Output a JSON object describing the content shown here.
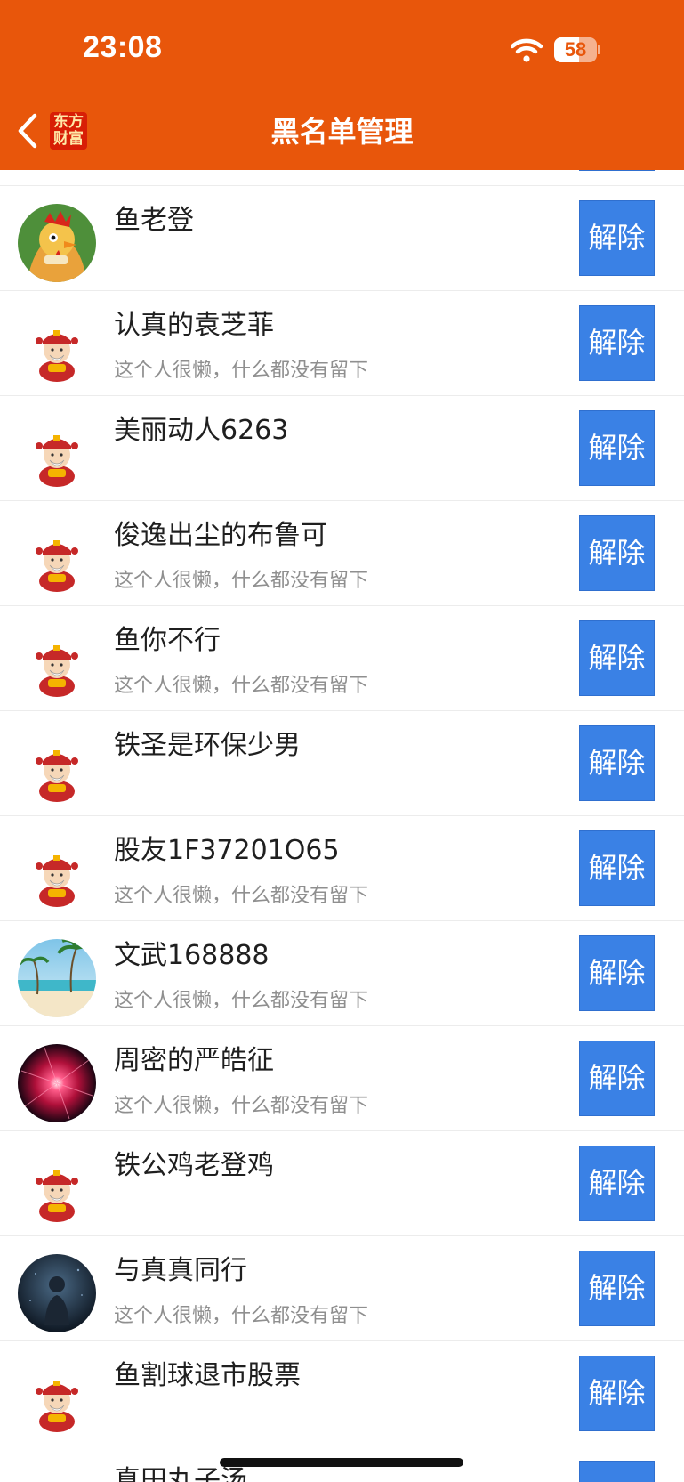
{
  "colors": {
    "brand": "#E8560B",
    "button": "#3A81E5"
  },
  "status_bar": {
    "time": "23:08",
    "battery": "58",
    "battery_level": 0.58
  },
  "header": {
    "title": "黑名单管理",
    "logo_line1": "东方",
    "logo_line2": "财富",
    "back_icon": "chevron-left-icon"
  },
  "list": {
    "button_label": "解除",
    "rows": [
      {
        "name": "鱼老登",
        "subtitle": "",
        "avatar": "rooster"
      },
      {
        "name": "认真的袁芝菲",
        "subtitle": "这个人很懒，什么都没有留下",
        "avatar": "god-of-wealth"
      },
      {
        "name": "美丽动人6263",
        "subtitle": "",
        "avatar": "god-of-wealth"
      },
      {
        "name": "俊逸出尘的布鲁可",
        "subtitle": "这个人很懒，什么都没有留下",
        "avatar": "god-of-wealth"
      },
      {
        "name": "鱼你不行",
        "subtitle": "这个人很懒，什么都没有留下",
        "avatar": "god-of-wealth"
      },
      {
        "name": "铁圣是环保少男",
        "subtitle": "",
        "avatar": "god-of-wealth"
      },
      {
        "name": "股友1F37201O65",
        "subtitle": "这个人很懒，什么都没有留下",
        "avatar": "god-of-wealth"
      },
      {
        "name": "文武168888",
        "subtitle": "这个人很懒，什么都没有留下",
        "avatar": "beach"
      },
      {
        "name": "周密的严皓征",
        "subtitle": "这个人很懒，什么都没有留下",
        "avatar": "red-burst"
      },
      {
        "name": "铁公鸡老登鸡",
        "subtitle": "",
        "avatar": "god-of-wealth"
      },
      {
        "name": "与真真同行",
        "subtitle": "这个人很懒，什么都没有留下",
        "avatar": "dark-figure"
      },
      {
        "name": "鱼割球退市股票",
        "subtitle": "",
        "avatar": "god-of-wealth"
      },
      {
        "name": "真田丸子汤",
        "subtitle": "",
        "avatar": "god-of-wealth"
      }
    ]
  }
}
